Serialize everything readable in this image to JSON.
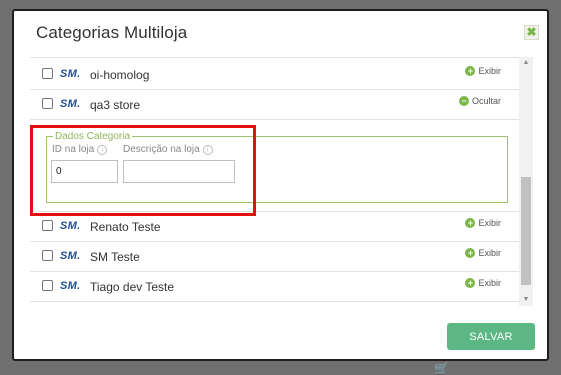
{
  "dialog": {
    "title": "Categorias Multiloja",
    "close_glyph": "✖",
    "save_label": "SALVAR"
  },
  "colors": {
    "accent_green": "#7ab648",
    "save_button": "#5cb785",
    "fieldset_border": "#9cc26b",
    "highlight_red": "#e40f0f",
    "logo_blue": "#1f4e96"
  },
  "stores_top": [
    {
      "logo": "SM.",
      "name": "oi-homolog",
      "action": "Exibir",
      "action_icon": "plus-circle-icon"
    },
    {
      "logo": "SM.",
      "name": "qa3 store",
      "action": "Ocultar",
      "action_icon": "minus-circle-icon"
    }
  ],
  "category_form": {
    "legend": "Dados Categoria",
    "id_label": "ID na loja",
    "id_value": "0",
    "desc_label": "Descrição na loja",
    "desc_value": ""
  },
  "stores_bottom": [
    {
      "logo": "SM.",
      "name": "Renato Teste",
      "action": "Exibir",
      "action_icon": "plus-circle-icon"
    },
    {
      "logo": "SM.",
      "name": "SM Teste",
      "action": "Exibir",
      "action_icon": "plus-circle-icon"
    },
    {
      "logo": "SM.",
      "name": "Tiago dev Teste",
      "action": "Exibir",
      "action_icon": "plus-circle-icon"
    }
  ]
}
